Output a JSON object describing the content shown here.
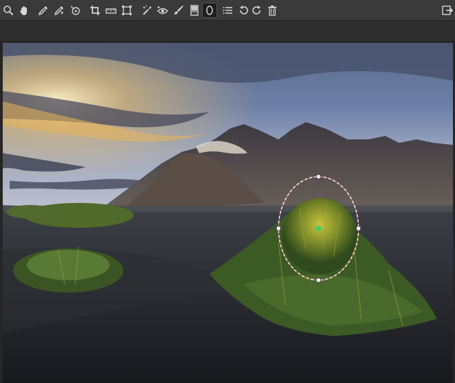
{
  "toolbar": {
    "left_tools": [
      {
        "name": "zoom-icon",
        "active": false
      },
      {
        "name": "hand-pan-icon",
        "active": false
      },
      {
        "name": "color-picker-icon",
        "active": false
      },
      {
        "name": "white-balance-picker-icon",
        "active": false
      },
      {
        "name": "color-sample-icon",
        "active": false
      },
      {
        "name": "crop-icon",
        "active": false
      },
      {
        "name": "straighten-icon",
        "active": false
      },
      {
        "name": "keystone-icon",
        "active": false
      },
      {
        "name": "spot-removal-icon",
        "active": false
      },
      {
        "name": "red-eye-icon",
        "active": false
      },
      {
        "name": "brush-icon",
        "active": false
      },
      {
        "name": "linear-gradient-icon",
        "active": false
      },
      {
        "name": "radial-gradient-icon",
        "active": true
      },
      {
        "name": "list-icon",
        "active": false
      },
      {
        "name": "undo-icon",
        "active": false
      },
      {
        "name": "redo-icon",
        "active": false
      },
      {
        "name": "trash-icon",
        "active": false
      }
    ],
    "right_tools": [
      {
        "name": "export-icon",
        "active": false
      }
    ]
  },
  "colors": {
    "toolbar_bg": "#3a3a3a",
    "icon": "#d6d6d6",
    "mask_center": "#3ecf6a",
    "viewer_bg": "#262626"
  }
}
